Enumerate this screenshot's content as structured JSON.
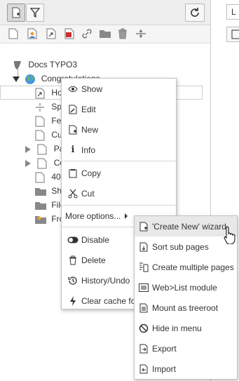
{
  "topbar": {
    "lang_select": "L"
  },
  "tree": {
    "root": "Docs TYPO3",
    "items": [
      "Congratulations",
      "Ho",
      "Spa",
      "Fea",
      "Cu",
      "Pa",
      "Co",
      "404",
      "Sha",
      "File",
      "Fro"
    ]
  },
  "context_menu": {
    "items": [
      {
        "label": "Show",
        "icon": "eye-icon"
      },
      {
        "label": "Edit",
        "icon": "pencil-icon"
      },
      {
        "label": "New",
        "icon": "new-page-icon"
      },
      {
        "label": "Info",
        "icon": "info-icon"
      },
      {
        "label": "Copy",
        "icon": "copy-icon"
      },
      {
        "label": "Cut",
        "icon": "scissors-icon"
      },
      {
        "label": "More options...",
        "icon": "caret-right-icon"
      },
      {
        "label": "Disable",
        "icon": "toggle-icon"
      },
      {
        "label": "Delete",
        "icon": "trash-icon"
      },
      {
        "label": "History/Undo",
        "icon": "history-icon"
      },
      {
        "label": "Clear cache fo",
        "icon": "bolt-icon"
      }
    ]
  },
  "submenu": {
    "items": [
      {
        "label": "'Create New' wizard",
        "icon": "wizard-icon"
      },
      {
        "label": "Sort sub pages",
        "icon": "sort-icon"
      },
      {
        "label": "Create multiple pages",
        "icon": "multi-pages-icon"
      },
      {
        "label": "Web>List module",
        "icon": "list-icon"
      },
      {
        "label": "Mount as treeroot",
        "icon": "mount-icon"
      },
      {
        "label": "Hide in menu",
        "icon": "hide-icon"
      },
      {
        "label": "Export",
        "icon": "export-icon"
      },
      {
        "label": "Import",
        "icon": "import-icon"
      }
    ]
  }
}
